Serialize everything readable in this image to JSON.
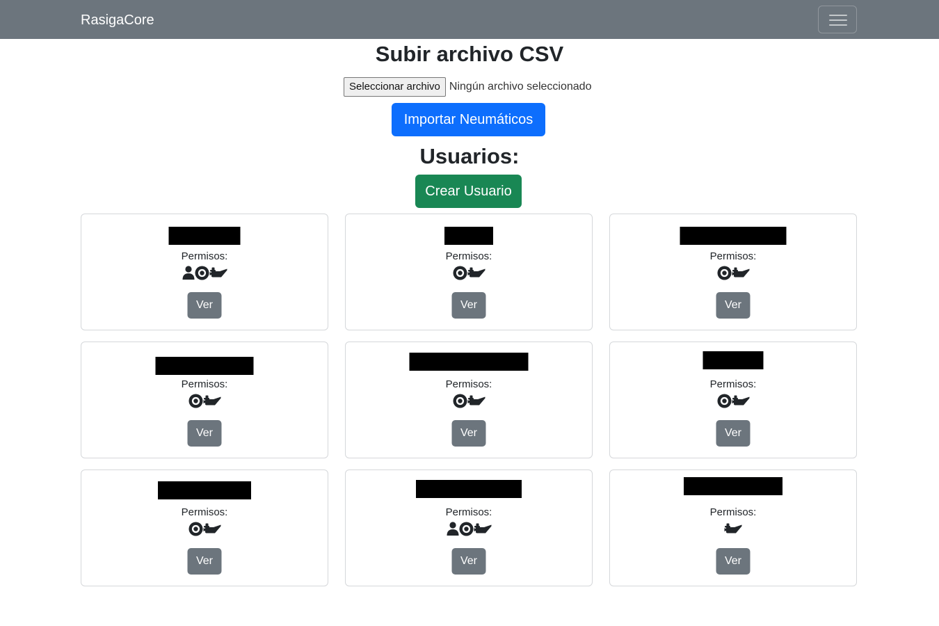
{
  "navbar": {
    "brand": "RasigaCore",
    "menu_icon": "hamburger-icon"
  },
  "upload": {
    "title": "Subir archivo CSV",
    "file_button_label": "Seleccionar archivo",
    "file_status": "Ningún archivo seleccionado",
    "import_button_label": "Importar Neumáticos"
  },
  "users": {
    "title": "Usuarios:",
    "create_button_label": "Crear Usuario",
    "cards": [
      {
        "name": "",
        "name_redacted": true,
        "permissions_label": "Permisos:",
        "permissions": [
          "user-icon",
          "tire-icon",
          "oil-can-icon"
        ],
        "view_label": "Ver"
      },
      {
        "name": "",
        "name_redacted": true,
        "permissions_label": "Permisos:",
        "permissions": [
          "tire-icon",
          "oil-can-icon"
        ],
        "view_label": "Ver"
      },
      {
        "name": "",
        "name_redacted": true,
        "permissions_label": "Permisos:",
        "permissions": [
          "tire-icon",
          "oil-can-icon"
        ],
        "view_label": "Ver"
      },
      {
        "name": "",
        "name_redacted": true,
        "permissions_label": "Permisos:",
        "permissions": [
          "tire-icon",
          "oil-can-icon"
        ],
        "view_label": "Ver"
      },
      {
        "name": "",
        "name_redacted": true,
        "permissions_label": "Permisos:",
        "permissions": [
          "tire-icon",
          "oil-can-icon"
        ],
        "view_label": "Ver"
      },
      {
        "name": "",
        "name_redacted": true,
        "permissions_label": "Permisos:",
        "permissions": [
          "tire-icon",
          "oil-can-icon"
        ],
        "view_label": "Ver"
      },
      {
        "name": "",
        "name_redacted": true,
        "permissions_label": "Permisos:",
        "permissions": [
          "tire-icon",
          "oil-can-icon"
        ],
        "view_label": "Ver"
      },
      {
        "name": "",
        "name_redacted": true,
        "permissions_label": "Permisos:",
        "permissions": [
          "user-icon",
          "tire-icon",
          "oil-can-icon"
        ],
        "view_label": "Ver"
      },
      {
        "name": "",
        "name_redacted": true,
        "permissions_label": "Permisos:",
        "permissions": [
          "oil-can-icon"
        ],
        "view_label": "Ver"
      }
    ]
  },
  "colors": {
    "navbar": "#6c757d",
    "primary": "#0d6efd",
    "success": "#198754",
    "secondary": "#6c757d",
    "icon": "#212529"
  }
}
